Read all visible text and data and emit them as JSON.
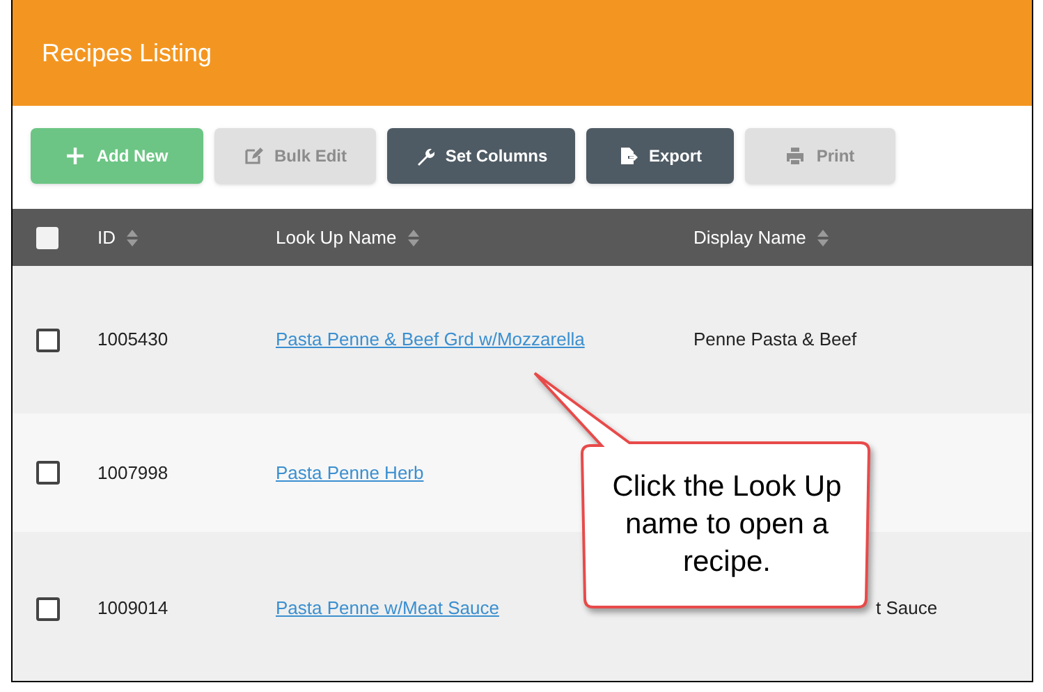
{
  "header": {
    "title": "Recipes Listing"
  },
  "toolbar": [
    {
      "label": "Add New",
      "disabled": false
    },
    {
      "label": "Bulk Edit",
      "disabled": true
    },
    {
      "label": "Set Columns",
      "disabled": false
    },
    {
      "label": "Export",
      "disabled": false
    },
    {
      "label": "Print",
      "disabled": true
    }
  ],
  "table": {
    "select_all_checked": false,
    "columns": [
      "ID",
      "Look Up Name",
      "Display Name"
    ],
    "rows": [
      {
        "checked": false,
        "id": "1005430",
        "lookup_name": "Pasta Penne & Beef Grd w/Mozzarella",
        "display_name": "Penne Pasta & Beef"
      },
      {
        "checked": false,
        "id": "1007998",
        "lookup_name": "Pasta Penne Herb"
      },
      {
        "checked": false,
        "id": "1009014",
        "lookup_name": "Pasta Penne w/Meat Sauce",
        "display_name": "t Sauce"
      }
    ]
  },
  "callout": {
    "text": "Click the Look Up name to open a recipe."
  }
}
